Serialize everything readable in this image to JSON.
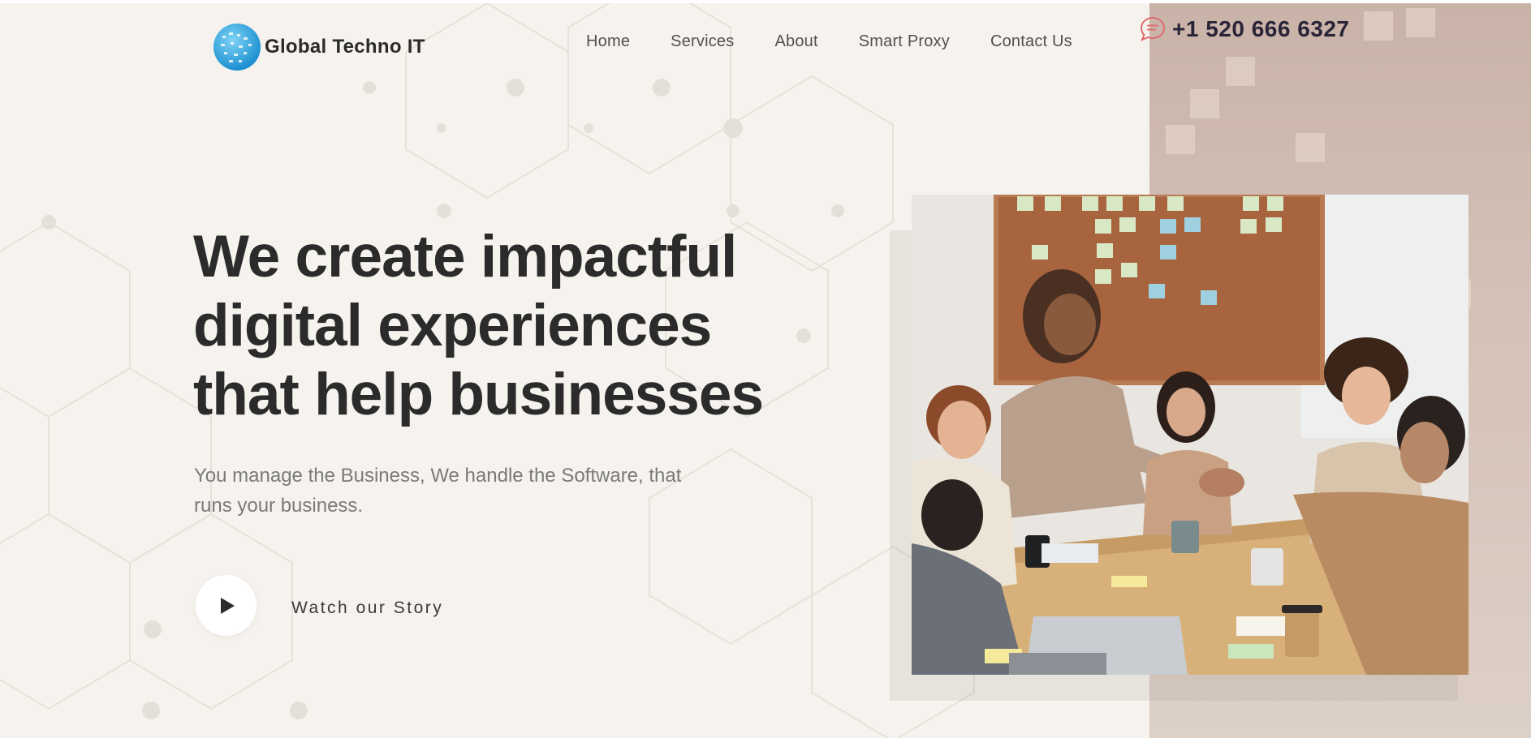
{
  "brand": {
    "name": "Global Techno IT"
  },
  "nav": {
    "items": [
      "Home",
      "Services",
      "About",
      "Smart Proxy",
      "Contact Us"
    ]
  },
  "contact": {
    "phone": "+1 520 666 6327",
    "icon": "chat-bubble-icon"
  },
  "hero": {
    "title_lines": [
      "We create impactful",
      "digital experiences",
      "that help businesses"
    ],
    "subtitle_lines": [
      "You manage the Business, We handle the Software, that",
      "runs your business."
    ],
    "watch_label": "Watch our Story",
    "play_icon": "play-icon"
  },
  "colors": {
    "accent": "#e06b72",
    "heading": "#2b2b2b",
    "background": "#f6f3ee",
    "panel": "#c9b3a9"
  }
}
